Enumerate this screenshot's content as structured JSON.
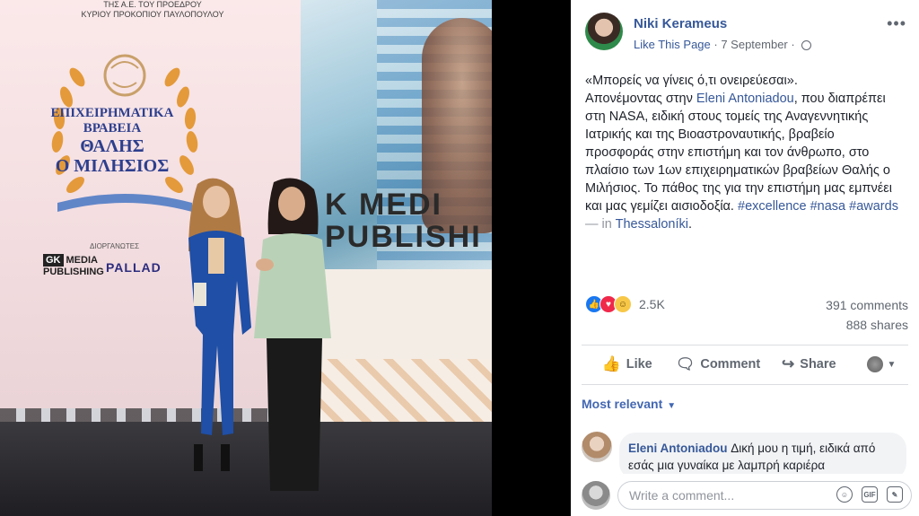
{
  "photo": {
    "top_line_1": "ΤΗΣ Α.Ε. ΤΟΥ ΠΡΟΕΔΡΟΥ",
    "top_line_2": "ΚΥΡΙΟΥ ΠΡΟΚΟΠΙΟΥ ΠΑΥΛΟΠΟΥΛΟΥ",
    "award_line_1": "ΕΠΙΧΕΙΡΗΜΑΤΙΚΑ",
    "award_line_2": "ΒΡΑΒΕΙΑ",
    "award_line_3": "ΘΑΛΗΣ",
    "award_line_4": "Ο ΜΙΛΗΣΙΟΣ",
    "sponsors_label": "ΔΙΟΡΓΑΝΩΤΕΣ",
    "gk_mark": "GK",
    "gk_media": "MEDIA",
    "gk_publishing": "PUBLISHING",
    "pallad": "PALLAD",
    "big_media_1": "K  MEDI",
    "big_media_2": "PUBLISHI"
  },
  "post": {
    "author": "Niki Kerameus",
    "like_page": "Like This Page",
    "date": "· 7 September ·",
    "text_quote": "«Μπορείς να γίνεις ό,τι ονειρεύεσαι».",
    "text_part1": "Απονέμοντας στην ",
    "mention": "Eleni Antoniadou",
    "text_part2": ", που διαπρέπει στη NASA, ειδική στους τομείς της Αναγεννητικής Ιατρικής και της Βιοαστροναυτικής, βραβείο προσφοράς στην επιστήμη και τον άνθρωπο, στο πλαίσιο των 1ων επιχειρηματικών βραβείων Θαλής ο Μιλήσιος. Το πάθος της για την επιστήμη μας εμπνέει και μας γεμίζει αισιοδοξία. ",
    "hashtags": "#excellence #nasa #awards",
    "location_prefix": " — in ",
    "location": "Thessaloníki",
    "location_suffix": "."
  },
  "stats": {
    "reactions_count": "2.5K",
    "comments": "391 comments",
    "shares": "888 shares"
  },
  "actions": {
    "like": "Like",
    "comment": "Comment",
    "share": "Share"
  },
  "comments": {
    "sort": "Most relevant",
    "items": [
      {
        "author": "Eleni Antoniadou",
        "text": " Δική μου η τιμή, ειδικά από εσάς μια γυναίκα με λαμπρή καριέρα"
      }
    ],
    "write_placeholder": "Write a comment...",
    "gif_label": "GIF"
  },
  "icons": {
    "more": "more-options-icon",
    "globe": "globe-icon",
    "like": "thumbs-up-icon",
    "comment": "speech-bubble-icon",
    "share": "share-arrow-icon"
  },
  "colors": {
    "link": "#365899",
    "accent": "#4267b2",
    "muted": "#606770"
  }
}
